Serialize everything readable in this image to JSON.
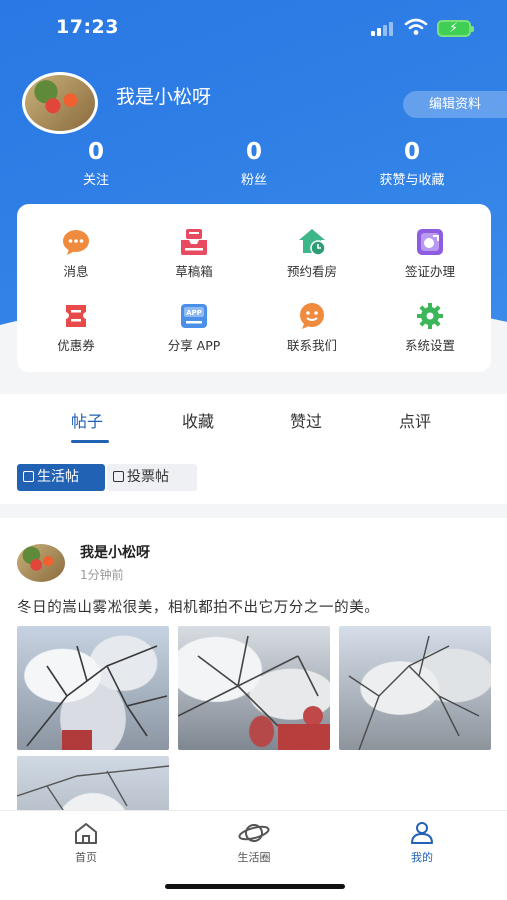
{
  "status": {
    "time": "17:23"
  },
  "profile": {
    "name": "我是小松呀",
    "edit_label": "编辑资料"
  },
  "stats": [
    {
      "value": "0",
      "label": "关注"
    },
    {
      "value": "0",
      "label": "粉丝"
    },
    {
      "value": "0",
      "label": "获赞与收藏"
    }
  ],
  "menu": [
    {
      "label": "消息",
      "icon": "chat-bubble-icon",
      "color": "#f08a3c"
    },
    {
      "label": "草稿箱",
      "icon": "drafts-tray-icon",
      "color": "#e84a5f"
    },
    {
      "label": "预约看房",
      "icon": "house-clock-icon",
      "color": "#3db68a"
    },
    {
      "label": "签证办理",
      "icon": "visa-card-icon",
      "color": "#8e5ce0"
    },
    {
      "label": "优惠券",
      "icon": "coupon-icon",
      "color": "#e84a4a"
    },
    {
      "label": "分享 APP",
      "icon": "app-share-icon",
      "color": "#4a8fe8"
    },
    {
      "label": "联系我们",
      "icon": "contact-smile-icon",
      "color": "#f08a3c"
    },
    {
      "label": "系统设置",
      "icon": "gear-icon",
      "color": "#3db65a"
    }
  ],
  "tabs": [
    {
      "label": "帖子",
      "active": true
    },
    {
      "label": "收藏",
      "active": false
    },
    {
      "label": "赞过",
      "active": false
    },
    {
      "label": "点评",
      "active": false
    }
  ],
  "chips": [
    {
      "label": "生活帖",
      "active": true
    },
    {
      "label": "投票帖",
      "active": false
    }
  ],
  "post": {
    "author": "我是小松呀",
    "time": "1分钟前",
    "text": "冬日的嵩山雾凇很美，相机都拍不出它万分之一的美。"
  },
  "tabbar": [
    {
      "label": "首页",
      "icon": "home-icon",
      "active": false
    },
    {
      "label": "生活圈",
      "icon": "planet-icon",
      "active": false
    },
    {
      "label": "我的",
      "icon": "person-icon",
      "active": true
    }
  ],
  "colors": {
    "brand": "#2262b5",
    "header": "#2f7fe6"
  }
}
